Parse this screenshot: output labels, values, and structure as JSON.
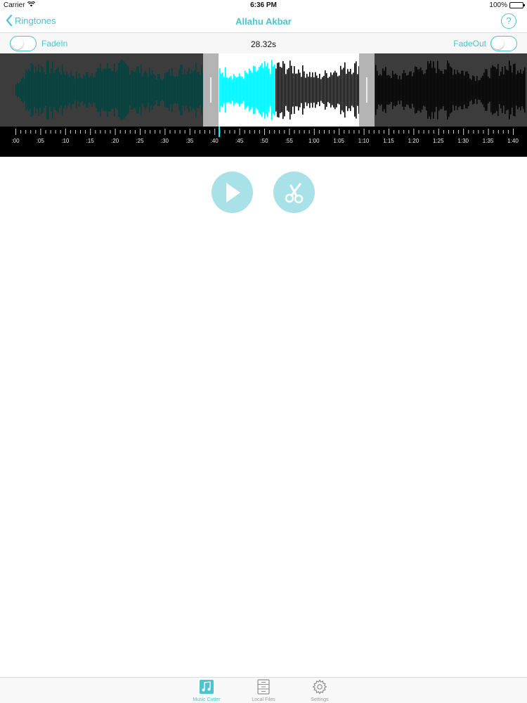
{
  "status_bar": {
    "carrier": "Carrier",
    "time": "6:36 PM",
    "battery": "100%"
  },
  "nav": {
    "back_label": "Ringtones",
    "title": "Allahu Akbar",
    "help_label": "?"
  },
  "fade": {
    "fade_in_label": "FadeIn",
    "fade_out_label": "FadeOut",
    "fade_in_on": false,
    "fade_out_on": false,
    "duration": "28.32s"
  },
  "timeline": {
    "labels": [
      ":00",
      ":05",
      ":10",
      ":15",
      ":20",
      ":25",
      ":30",
      ":35",
      ":40",
      ":45",
      ":50",
      ":55",
      "1:00",
      "1:05",
      "1:10",
      "1:15",
      "1:20",
      "1:25",
      "1:30",
      "1:35",
      "1:40"
    ]
  },
  "colors": {
    "accent": "#4cc3d0",
    "waveform_played": "#00f2fa",
    "waveform_dim": "#083f3f",
    "control_bg": "#a8e1e7"
  },
  "controls": {
    "play_icon": "play-icon",
    "cut_icon": "scissors-icon"
  },
  "tabs": [
    {
      "label": "Music Cutter",
      "icon": "music-note-icon",
      "active": true
    },
    {
      "label": "Local Files",
      "icon": "file-cabinet-icon",
      "active": false
    },
    {
      "label": "Settings",
      "icon": "gear-icon",
      "active": false
    }
  ]
}
